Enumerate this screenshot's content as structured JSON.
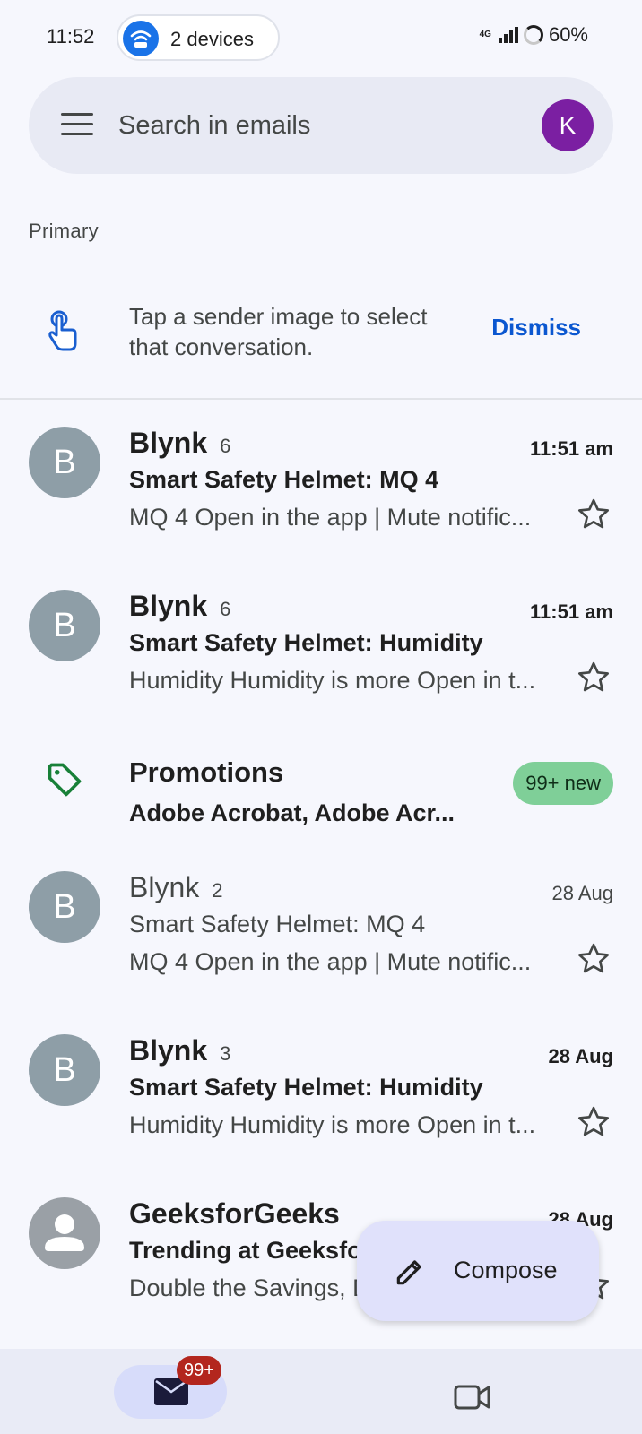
{
  "status_bar": {
    "time": "11:52",
    "hotspot_label": "2 devices",
    "network": "4G",
    "battery": "60%"
  },
  "search": {
    "placeholder": "Search in emails",
    "avatar_letter": "K"
  },
  "section": {
    "label": "Primary"
  },
  "tip": {
    "text": "Tap a sender image to select that conversation.",
    "dismiss_label": "Dismiss"
  },
  "emails": [
    {
      "avatar": "B",
      "sender": "Blynk",
      "count": "6",
      "time": "11:51 am",
      "subject": "Smart Safety Helmet: MQ 4",
      "snippet": "MQ 4 Open in the app | Mute notific...",
      "unread": true
    },
    {
      "avatar": "B",
      "sender": "Blynk",
      "count": "6",
      "time": "11:51 am",
      "subject": "Smart Safety Helmet: Humidity",
      "snippet": "Humidity Humidity is more Open in t...",
      "unread": true
    },
    {
      "avatar": "B",
      "sender": "Blynk",
      "count": "2",
      "time": "28 Aug",
      "subject": "Smart Safety Helmet: MQ 4",
      "snippet": "MQ 4 Open in the app | Mute notific...",
      "unread": false
    },
    {
      "avatar": "B",
      "sender": "Blynk",
      "count": "3",
      "time": "28 Aug",
      "subject": "Smart Safety Helmet: Humidity",
      "snippet": "Humidity Humidity is more Open in t...",
      "unread": true
    },
    {
      "avatar": "",
      "sender": "GeeksforGeeks",
      "count": "",
      "time": "28 Aug",
      "subject": "Trending at GeeksforGeeks",
      "snippet": "Double the Savings, Double the Skills",
      "unread": true
    }
  ],
  "promotions": {
    "title": "Promotions",
    "senders": "Adobe Acrobat, Adobe Acr...",
    "badge": "99+ new"
  },
  "compose": {
    "label": "Compose"
  },
  "bottom_nav": {
    "mail_badge": "99+"
  },
  "colors": {
    "accent": "#0b57d0",
    "avatar_k": "#7b1fa2",
    "promo_badge": "#7fcf98",
    "mail_badge": "#b3261e"
  },
  "icons": {
    "hotspot": "hotspot-icon",
    "menu": "menu-icon",
    "tip": "tap-hand-icon",
    "star": "star-icon",
    "tag": "tag-icon",
    "compose": "pencil-icon",
    "mail": "mail-icon",
    "meet": "video-camera-icon"
  }
}
